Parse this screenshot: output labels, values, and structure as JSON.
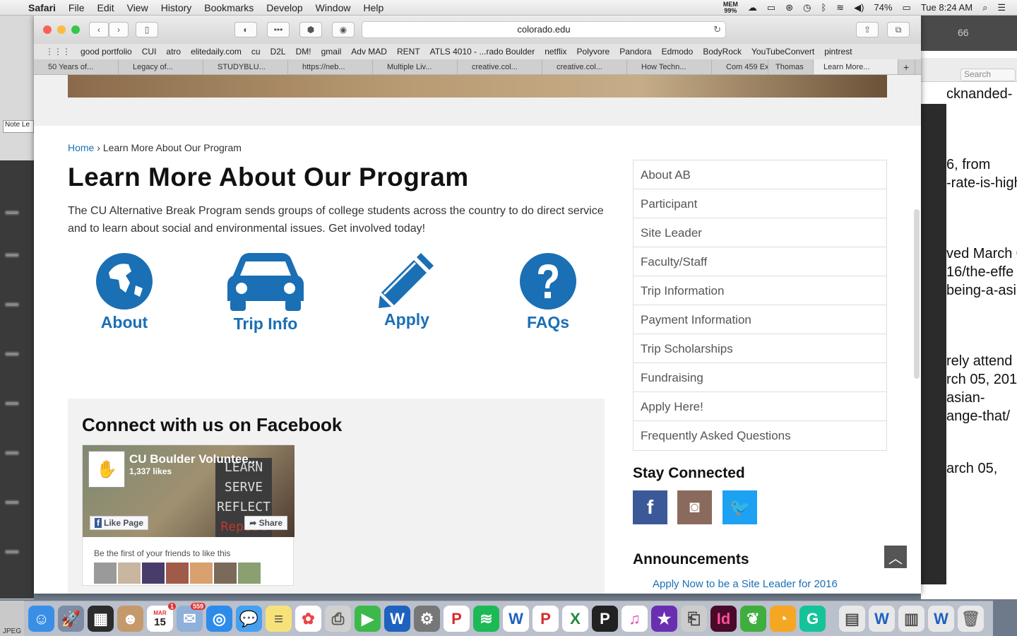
{
  "menubar": {
    "app": "Safari",
    "menus": [
      "File",
      "Edit",
      "View",
      "History",
      "Bookmarks",
      "Develop",
      "Window",
      "Help"
    ],
    "mem": "MEM\n99%",
    "battery": "74%",
    "clock": "Tue 8:24 AM"
  },
  "browser": {
    "url": "colorado.edu",
    "bookmarks": [
      "good portfolio",
      "CUI",
      "atro",
      "elitedaily.com",
      "cu",
      "D2L",
      "DM!",
      "gmail",
      "Adv MAD",
      "RENT",
      "ATLS 4010 - ...rado Boulder",
      "netflix",
      "Polyvore",
      "Pandora",
      "Edmodo",
      "BodyRock",
      "YouTubeConvert",
      "pintrest"
    ],
    "tabs": [
      "50 Years of...",
      "Legacy of...",
      "STUDYBLU...",
      "https://neb...",
      "Multiple Liv...",
      "creative.col...",
      "creative.col...",
      "How Techn...",
      "Com 459 Ex",
      "Thomas",
      "Learn More..."
    ]
  },
  "page": {
    "breadcrumb_home": "Home",
    "breadcrumb_sep": " › ",
    "breadcrumb_current": "Learn More About Our Program",
    "title": "Learn More About Our Program",
    "intro": "The CU Alternative Break Program sends groups of college students across the country to do direct service and to learn about social and environmental issues. Get involved today!",
    "quick_links": [
      {
        "label": "About",
        "icon": "globe-icon"
      },
      {
        "label": "Trip Info",
        "icon": "car-icon"
      },
      {
        "label": "Apply",
        "icon": "pencil-icon"
      },
      {
        "label": "FAQs",
        "icon": "question-icon"
      }
    ],
    "facebook": {
      "heading": "Connect with us on Facebook",
      "page_name": "CU Boulder Voluntee...",
      "likes": "1,337 likes",
      "like_button": "Like Page",
      "share_button": "Share",
      "friends_text": "Be the first of your friends to like this",
      "cover_text": [
        "LEARN",
        "SERVE",
        "REFLECT",
        "Repeat"
      ]
    },
    "sidenav": [
      "About AB",
      "Participant",
      "Site Leader",
      "Faculty/Staff",
      "Trip Information",
      "Payment Information",
      "Trip Scholarships",
      "Fundraising",
      "Apply Here!",
      "Frequently Asked Questions"
    ],
    "stay_connected": "Stay Connected",
    "social": [
      {
        "name": "facebook-icon",
        "glyph": "f",
        "color": "#3b5998"
      },
      {
        "name": "instagram-icon",
        "glyph": "◘",
        "color": "#8a6a5c"
      },
      {
        "name": "twitter-icon",
        "glyph": "🐦",
        "color": "#1da1f2"
      }
    ],
    "announcements": "Announcements",
    "announcement_link": "Apply Now to be a Site Leader for 2016"
  },
  "background_doc": {
    "lines": [
      "cknanded-",
      "6, from",
      "-rate-is-high",
      "ved March 0",
      "16/the-effe",
      "being-a-asi",
      "rely attend",
      "rch 05, 201",
      "asian-",
      "ange-that/",
      "arch 05,"
    ],
    "search_placeholder": "Search",
    "number": "66"
  },
  "left_app": {
    "note": "Note Le",
    "jpeg": "JPEG"
  },
  "dock": {
    "calendar_day": "15",
    "calendar_month": "MAR",
    "calendar_badge": "1",
    "mail_badge": "559"
  },
  "colors": {
    "brand_blue": "#1a6fb5"
  }
}
